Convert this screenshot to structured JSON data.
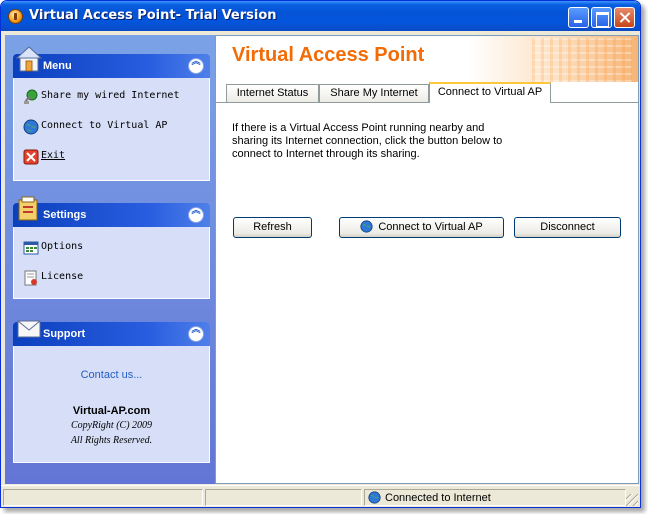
{
  "window": {
    "title": "Virtual Access Point- Trial Version"
  },
  "sidebar": {
    "menu": {
      "title": "Menu",
      "items": [
        {
          "label": "Share my wired Internet",
          "icon": "share-internet-icon"
        },
        {
          "label": "Connect to Virtual AP",
          "icon": "globe-icon"
        },
        {
          "label": "Exit",
          "icon": "exit-icon"
        }
      ]
    },
    "settings": {
      "title": "Settings",
      "items": [
        {
          "label": "Options",
          "icon": "options-icon"
        },
        {
          "label": "License",
          "icon": "license-icon"
        }
      ]
    },
    "support": {
      "title": "Support",
      "contact": "Contact us...",
      "site": "Virtual-AP.com",
      "copyright": "CopyRight (C) 2009",
      "rights": "All Rights Reserved."
    }
  },
  "main": {
    "title": "Virtual Access Point",
    "tabs": [
      {
        "label": "Internet Status"
      },
      {
        "label": "Share My Internet"
      },
      {
        "label": "Connect to Virtual AP"
      }
    ],
    "active_tab": "Connect to Virtual AP",
    "description": "If there is a Virtual Access Point running nearby and sharing its Internet connection, click the button below to connect to Internet through its sharing.",
    "buttons": {
      "refresh": "Refresh",
      "connect": "Connect to Virtual AP",
      "disconnect": "Disconnect"
    }
  },
  "statusbar": {
    "status": "Connected to Internet"
  },
  "colors": {
    "title_orange": "#f26b05",
    "titlebar_blue": "#0453d6",
    "link_blue": "#215dc6"
  }
}
